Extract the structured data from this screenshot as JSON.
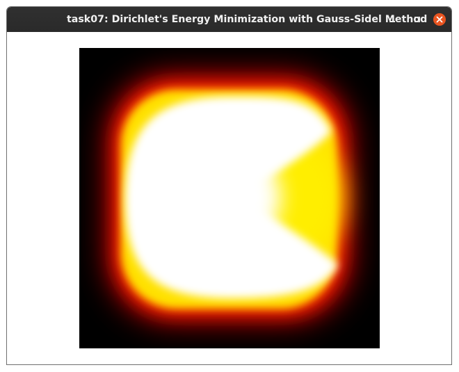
{
  "window": {
    "title": "task07: Dirichlet's Energy Minimization with Gauss-Sidel Method"
  },
  "controls": {
    "minimize_icon": "minimize-icon",
    "maximize_icon": "maximize-icon",
    "close_icon": "close-icon"
  },
  "colors": {
    "titlebar": "#2b2b2b",
    "close_button": "#e95420",
    "heatmap_low": "#000000",
    "heatmap_mid": "#ff0000",
    "heatmap_high": "#ffff00",
    "heatmap_max": "#ffffff"
  },
  "visualization": {
    "type": "heatmap",
    "colormap": "black-red-yellow-white",
    "shape": "C-shaped white region with opening on right"
  }
}
